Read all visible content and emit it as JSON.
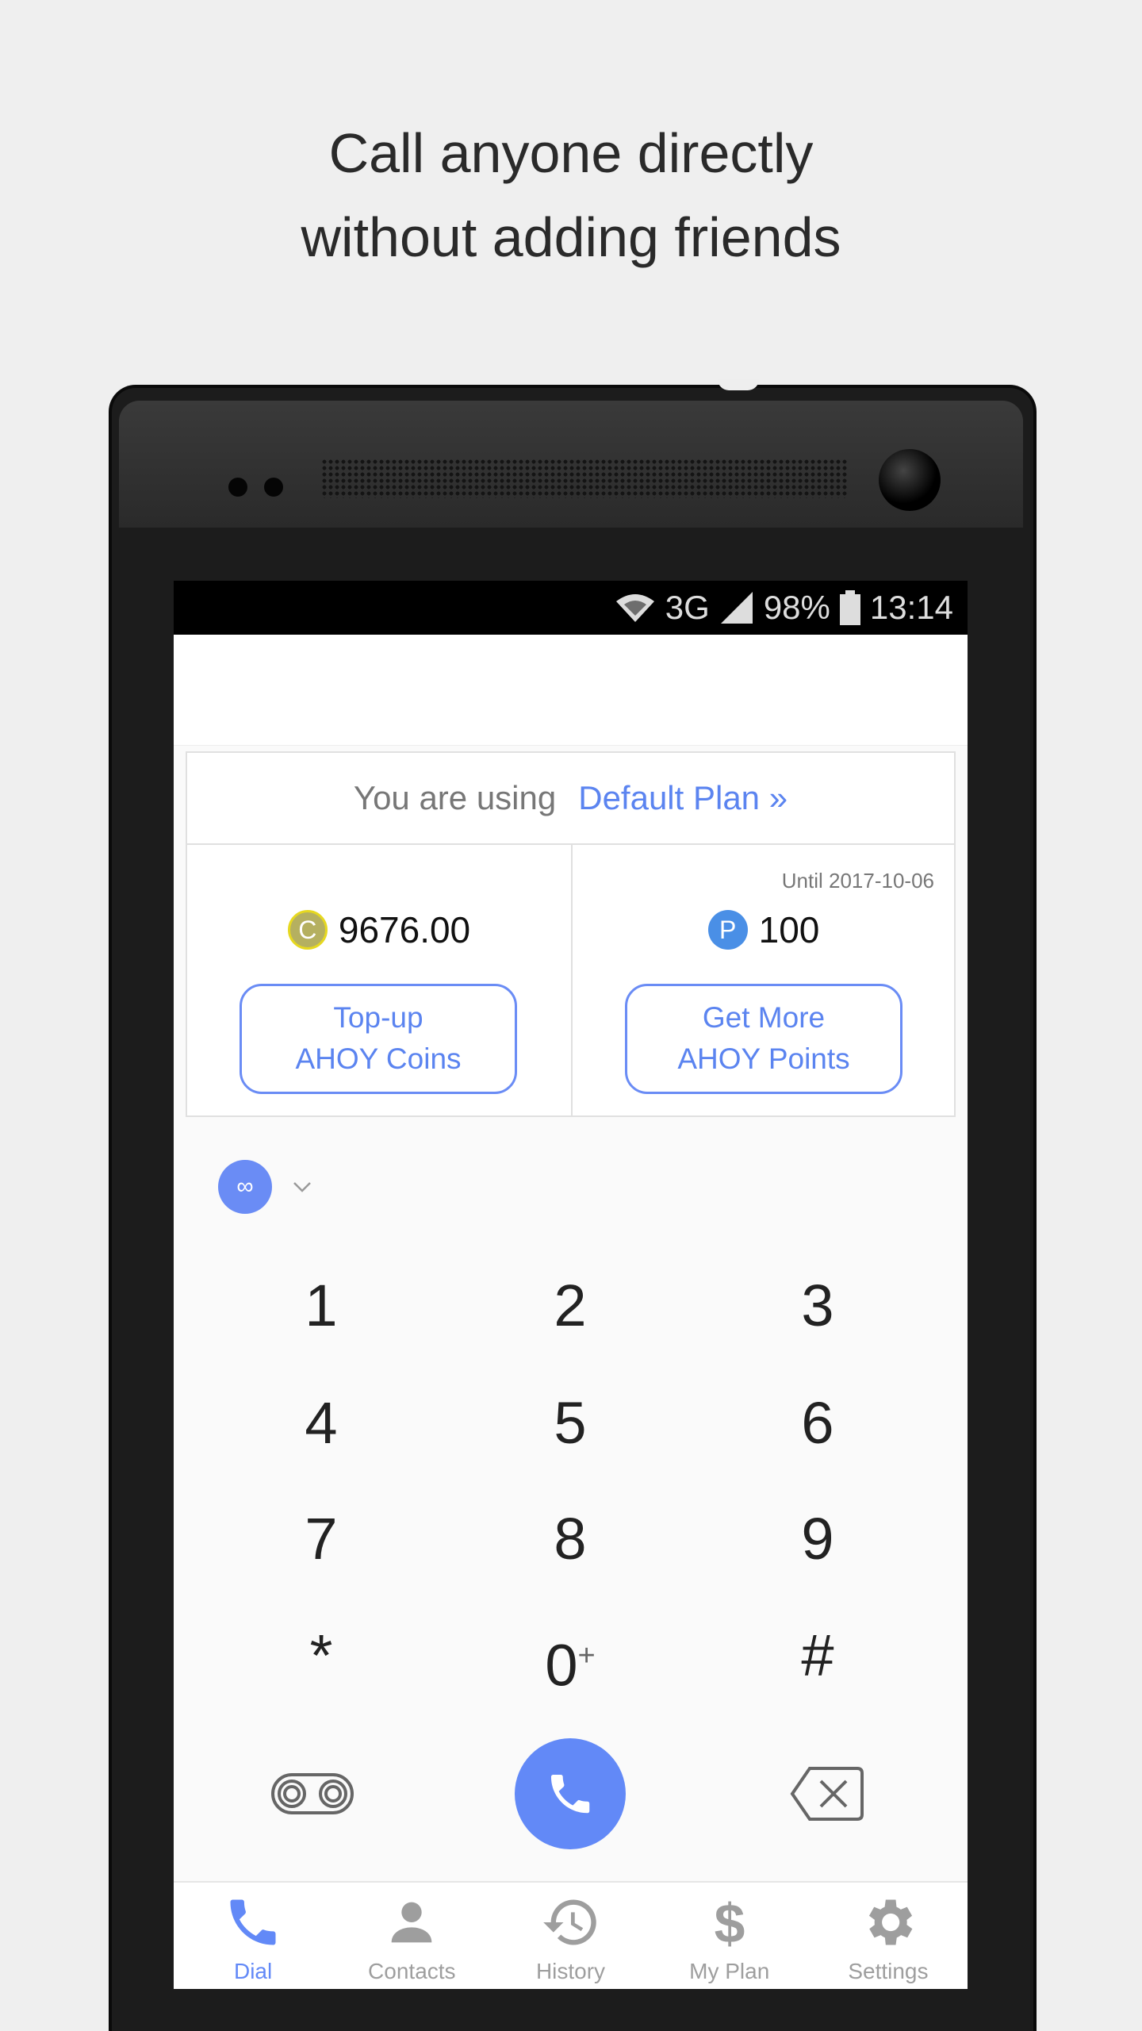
{
  "headline": {
    "line1": "Call anyone directly",
    "line2": "without adding friends"
  },
  "status_bar": {
    "network": "3G",
    "battery": "98%",
    "time": "13:14"
  },
  "plan": {
    "using_label": "You are using",
    "plan_name": "Default Plan »",
    "coins": {
      "balance": "9676.00",
      "icon": "C",
      "button_line1": "Top-up",
      "button_line2": "AHOY Coins"
    },
    "points": {
      "expiry": "Until 2017-10-06",
      "balance": "100",
      "icon": "P",
      "button_line1": "Get More",
      "button_line2": "AHOY Points"
    }
  },
  "keypad": {
    "keys": [
      "1",
      "2",
      "3",
      "4",
      "5",
      "6",
      "7",
      "8",
      "9",
      "*",
      "0",
      "#"
    ],
    "zero_sub": "+"
  },
  "nav": [
    {
      "label": "Dial",
      "active": true
    },
    {
      "label": "Contacts"
    },
    {
      "label": "History"
    },
    {
      "label": "My Plan"
    },
    {
      "label": "Settings"
    }
  ],
  "colors": {
    "accent": "#6289f7",
    "inactive": "#9e9e9e"
  }
}
